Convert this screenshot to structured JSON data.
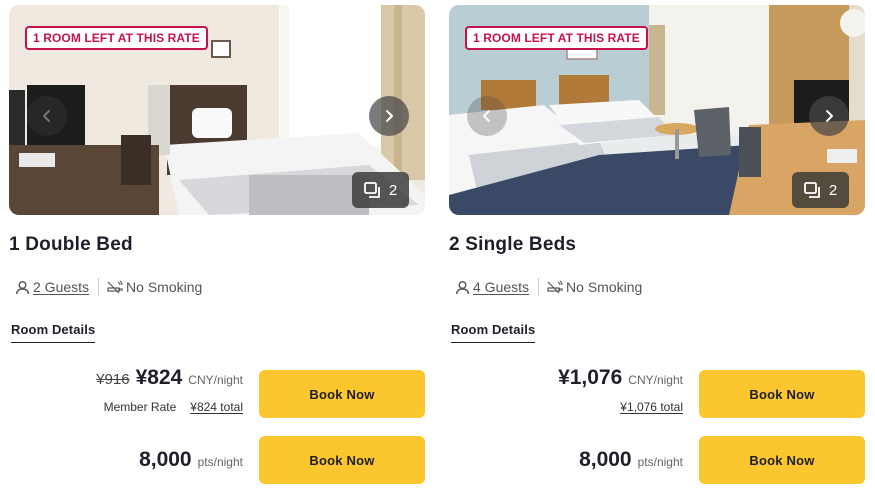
{
  "rooms": [
    {
      "badge": "1 ROOM LEFT AT THIS RATE",
      "photo_count": "2",
      "title": "1 Double Bed",
      "guests": "2 Guests",
      "smoking": "No Smoking",
      "details_label": "Room Details",
      "old_price": "¥916",
      "price": "¥824",
      "price_unit": "CNY/night",
      "member_label": "Member Rate",
      "total": "¥824 total",
      "points": "8,000",
      "points_unit": "pts/night",
      "book_label": "Book Now",
      "icons": {
        "prev": "chevron-left-icon",
        "next": "chevron-right-icon",
        "gallery": "gallery-icon",
        "guests": "person-icon",
        "smoking": "no-smoking-icon"
      }
    },
    {
      "badge": "1 ROOM LEFT AT THIS RATE",
      "photo_count": "2",
      "title": "2 Single Beds",
      "guests": "4 Guests",
      "smoking": "No Smoking",
      "details_label": "Room Details",
      "price": "¥1,076",
      "price_unit": "CNY/night",
      "total": "¥1,076 total",
      "points": "8,000",
      "points_unit": "pts/night",
      "book_label": "Book Now",
      "icons": {
        "prev": "chevron-left-icon",
        "next": "chevron-right-icon",
        "gallery": "gallery-icon",
        "guests": "person-icon",
        "smoking": "no-smoking-icon"
      }
    }
  ],
  "colors": {
    "accent": "#fcc62e",
    "badge": "#c4124f",
    "text": "#1f1f2b"
  }
}
